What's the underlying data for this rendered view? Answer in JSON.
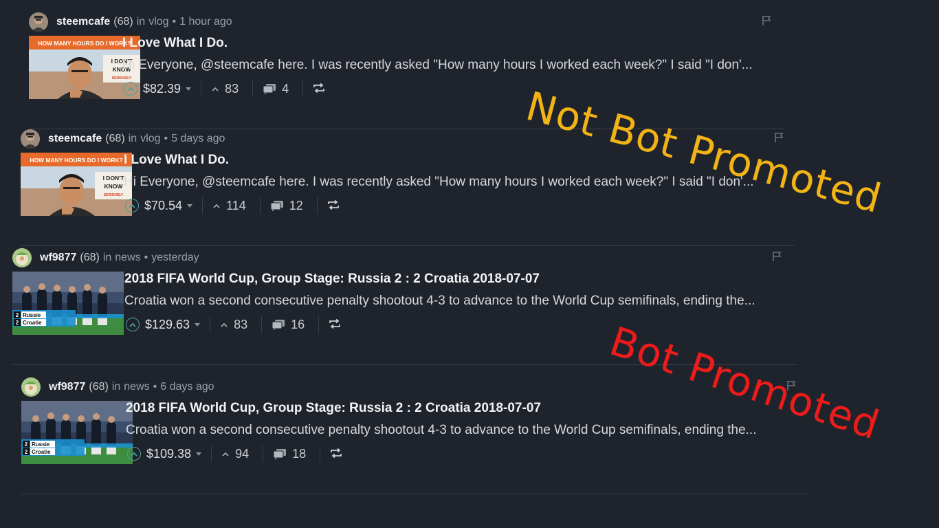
{
  "colors": {
    "background": "#1f232b",
    "divider": "#3a3f47",
    "author": "#f2f4f6",
    "meta": "#9aa0a8",
    "vote_accent": "#4ba2a0",
    "overlay_not_bot": "#f2b317",
    "overlay_bot": "#ee1b1b"
  },
  "posts": [
    {
      "author": "steemcafe",
      "reputation": "(68)",
      "in_word": "in",
      "category": "vlog",
      "dot": "•",
      "time": "1 hour ago",
      "title": "I Love What I Do.",
      "excerpt": "Hi Everyone, @steemcafe here. I was recently asked \"How many hours I worked each week?\" I said \"I don'...",
      "payout": "$82.39",
      "votes": "83",
      "comments": "4",
      "thumbnail": {
        "kind": "vlog",
        "banner": "HOW MANY HOURS DO I WORK?",
        "sign_line1": "I DON'T",
        "sign_line2": "KNOW",
        "sign_line3": "SERIOUSLY"
      },
      "icons": {
        "flag": "flag-icon",
        "upvote": "upvote-chevron-icon",
        "votes": "caret-up-icon",
        "comments": "comments-icon",
        "reblog": "reblog-icon"
      }
    },
    {
      "author": "steemcafe",
      "reputation": "(68)",
      "in_word": "in",
      "category": "vlog",
      "dot": "•",
      "time": "5 days ago",
      "title": "I Love What I Do.",
      "excerpt": "Hi Everyone, @steemcafe here. I was recently asked \"How many hours I worked each week?\" I said \"I don'...",
      "payout": "$70.54",
      "votes": "114",
      "comments": "12",
      "thumbnail": {
        "kind": "vlog",
        "banner": "HOW MANY HOURS DO I WORK?",
        "sign_line1": "I DON'T",
        "sign_line2": "KNOW",
        "sign_line3": "SERIOUSLY"
      },
      "icons": {
        "flag": "flag-icon",
        "upvote": "upvote-chevron-icon",
        "votes": "caret-up-icon",
        "comments": "comments-icon",
        "reblog": "reblog-icon"
      }
    },
    {
      "author": "wf9877",
      "reputation": "(68)",
      "in_word": "in",
      "category": "news",
      "dot": "•",
      "time": "yesterday",
      "title": "2018 FIFA World Cup, Group Stage: Russia 2 : 2 Croatia 2018-07-07",
      "excerpt": "Croatia won a second consecutive penalty shootout 4-3 to advance to the World Cup semifinals, ending the...",
      "payout": "$129.63",
      "votes": "83",
      "comments": "16",
      "thumbnail": {
        "kind": "football",
        "score1": "2",
        "team1": "Russie",
        "score2": "2",
        "team2": "Croatie"
      },
      "icons": {
        "flag": "flag-icon",
        "upvote": "upvote-chevron-icon",
        "votes": "caret-up-icon",
        "comments": "comments-icon",
        "reblog": "reblog-icon"
      }
    },
    {
      "author": "wf9877",
      "reputation": "(68)",
      "in_word": "in",
      "category": "news",
      "dot": "•",
      "time": "6 days ago",
      "title": "2018 FIFA World Cup, Group Stage: Russia 2 : 2 Croatia 2018-07-07",
      "excerpt": "Croatia won a second consecutive penalty shootout 4-3 to advance to the World Cup semifinals, ending the...",
      "payout": "$109.38",
      "votes": "94",
      "comments": "18",
      "thumbnail": {
        "kind": "football",
        "score1": "2",
        "team1": "Russie",
        "score2": "2",
        "team2": "Croatie"
      },
      "icons": {
        "flag": "flag-icon",
        "upvote": "upvote-chevron-icon",
        "votes": "caret-up-icon",
        "comments": "comments-icon",
        "reblog": "reblog-icon"
      }
    }
  ],
  "overlays": {
    "not_bot": "Not Bot Promoted",
    "bot": "Bot Promoted"
  }
}
